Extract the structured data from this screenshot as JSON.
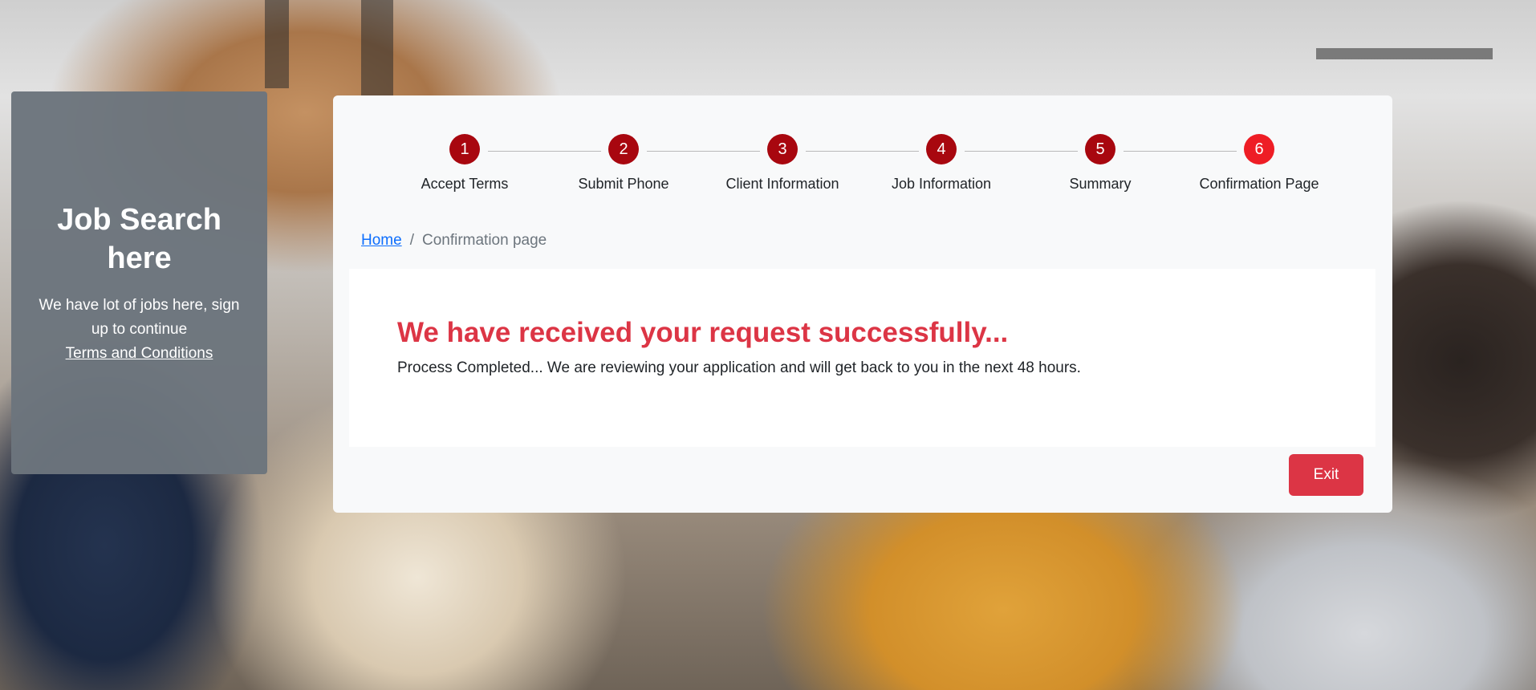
{
  "side_card": {
    "title": "Job Search here",
    "text": "We have lot of jobs here, sign up to continue",
    "link": "Terms and Conditions"
  },
  "stepper": {
    "steps": [
      {
        "number": "1",
        "label": "Accept Terms"
      },
      {
        "number": "2",
        "label": "Submit Phone"
      },
      {
        "number": "3",
        "label": "Client Information"
      },
      {
        "number": "4",
        "label": "Job Information"
      },
      {
        "number": "5",
        "label": "Summary"
      },
      {
        "number": "6",
        "label": "Confirmation Page"
      }
    ],
    "active_step": 6,
    "colors": {
      "completed": "#a8070f",
      "active": "#ee1d25"
    }
  },
  "breadcrumb": {
    "home": "Home",
    "separator": "/",
    "current": "Confirmation page"
  },
  "confirmation": {
    "headline": "We have received your request successfully...",
    "message": "Process Completed... We are reviewing your application and will get back to you in the next 48 hours."
  },
  "actions": {
    "exit_label": "Exit"
  },
  "colors": {
    "accent": "#dc3545",
    "link": "#0d6efd",
    "side_card_bg": "#6c757d"
  }
}
